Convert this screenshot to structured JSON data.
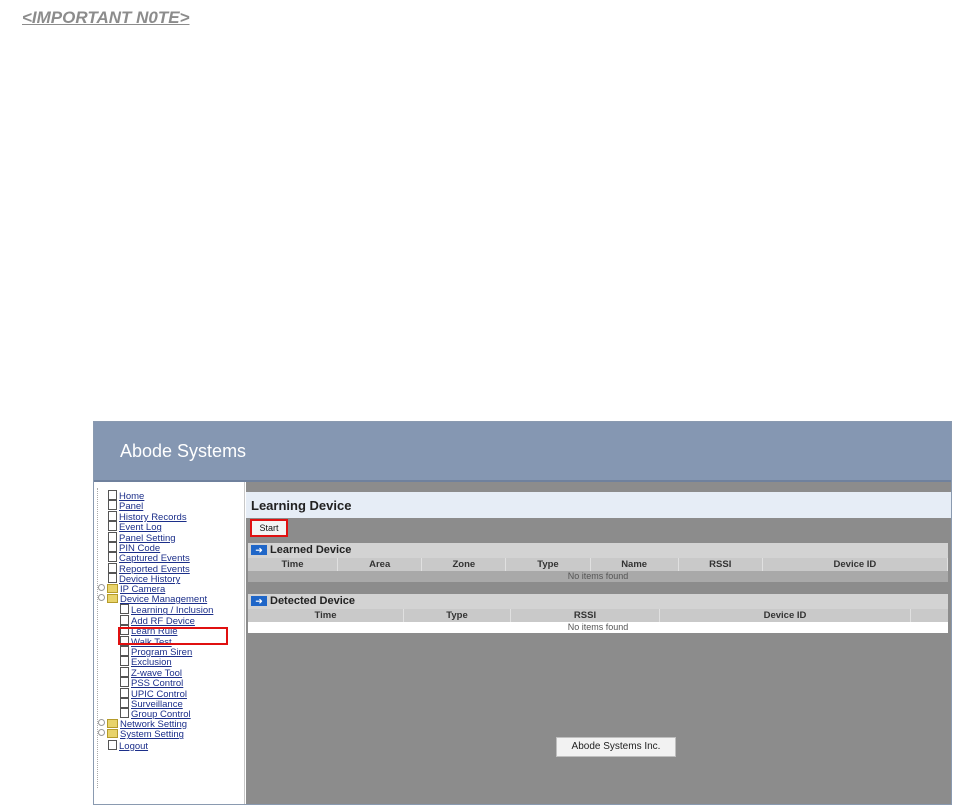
{
  "note": "<IMPORTANT N0TE>",
  "banner": {
    "title": "Abode Systems"
  },
  "sidebar": {
    "items": [
      {
        "label": "Home",
        "kind": "doc"
      },
      {
        "label": "Panel",
        "kind": "doc"
      },
      {
        "label": "History Records",
        "kind": "doc"
      },
      {
        "label": "Event Log",
        "kind": "doc"
      },
      {
        "label": "Panel Setting",
        "kind": "doc"
      },
      {
        "label": "PIN Code",
        "kind": "doc"
      },
      {
        "label": "Captured Events",
        "kind": "doc"
      },
      {
        "label": "Reported Events",
        "kind": "doc"
      },
      {
        "label": "Device History",
        "kind": "doc"
      },
      {
        "label": "IP Camera",
        "kind": "folder"
      },
      {
        "label": "Device Management",
        "kind": "folder"
      },
      {
        "label": "Learning / Inclusion",
        "kind": "doc",
        "selected": true
      },
      {
        "label": "Add RF Device",
        "kind": "doc"
      },
      {
        "label": "Learn Rule",
        "kind": "doc"
      },
      {
        "label": "Walk Test",
        "kind": "doc"
      },
      {
        "label": "Program Siren",
        "kind": "doc"
      },
      {
        "label": "Exclusion",
        "kind": "doc"
      },
      {
        "label": "Z-wave Tool",
        "kind": "doc"
      },
      {
        "label": "PSS Control",
        "kind": "doc"
      },
      {
        "label": "UPIC Control",
        "kind": "doc"
      },
      {
        "label": "Surveillance",
        "kind": "doc"
      },
      {
        "label": "Group Control",
        "kind": "doc"
      },
      {
        "label": "Network Setting",
        "kind": "folder"
      },
      {
        "label": "System Setting",
        "kind": "folder"
      },
      {
        "label": "Logout",
        "kind": "doc"
      }
    ]
  },
  "main": {
    "title": "Learning Device",
    "start_label": "Start",
    "learned": {
      "heading": "Learned Device",
      "columns": [
        "Time",
        "Area",
        "Zone",
        "Type",
        "Name",
        "RSSI",
        "Device ID"
      ],
      "empty": "No items found"
    },
    "detected": {
      "heading": "Detected Device",
      "columns": [
        "Time",
        "Type",
        "RSSI",
        "Device ID"
      ],
      "empty": "No items found"
    },
    "footer": "Abode Systems Inc."
  },
  "colors": {
    "banner": "#8597b2",
    "content_bg": "#8c8c8c",
    "highlight": "#e01010",
    "link": "#1c2f8a"
  }
}
